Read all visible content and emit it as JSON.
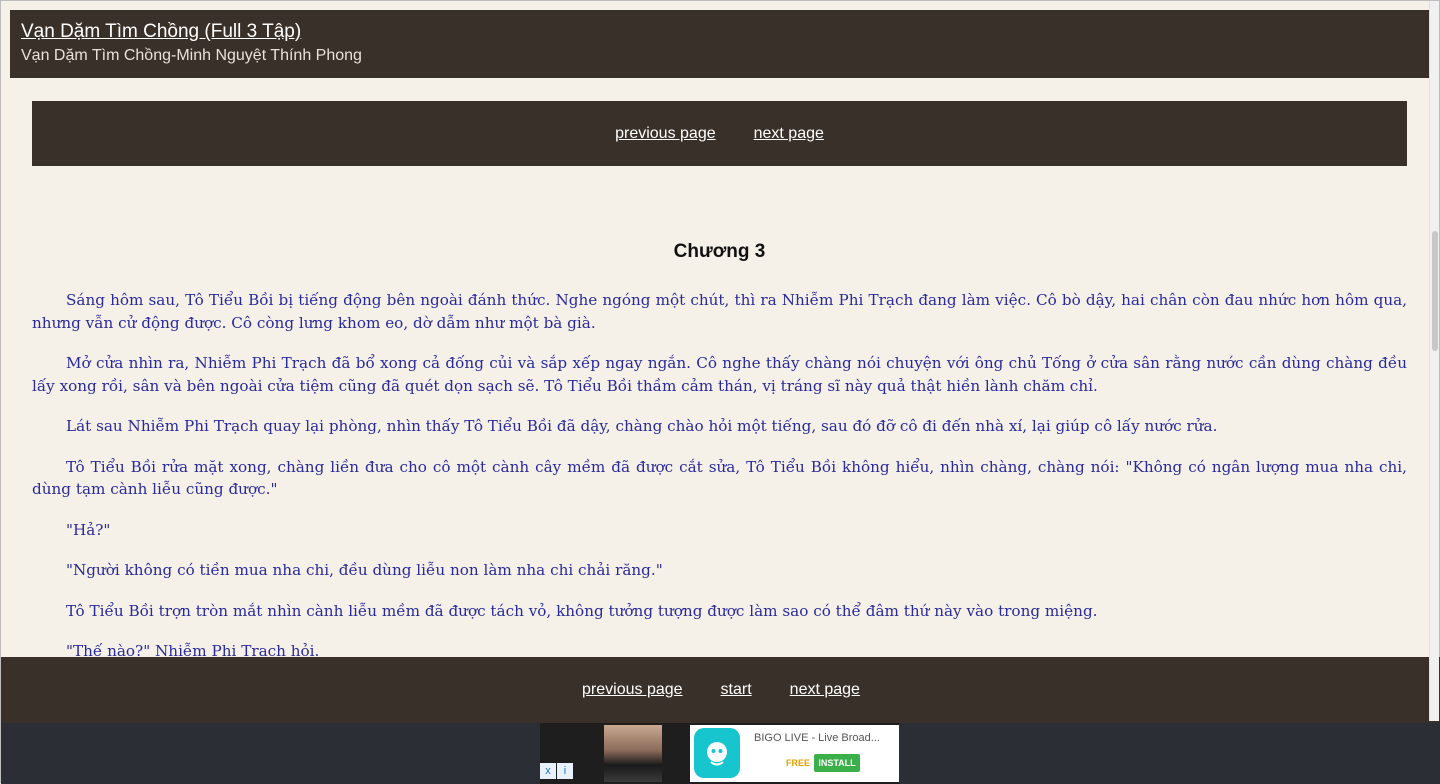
{
  "header": {
    "title": "Vạn Dặm Tìm Chồng (Full 3 Tập)",
    "subtitle": "Vạn Dặm Tìm Chồng-Minh Nguyệt Thính Phong"
  },
  "topnav": {
    "previous": "previous page",
    "next": "next page"
  },
  "chapter": {
    "title": "Chương 3",
    "paragraphs": [
      "Sáng hôm sau, Tô Tiểu Bồi bị tiếng động bên ngoài đánh thức. Nghe ngóng một chút, thì ra Nhiễm Phi Trạch đang làm việc. Cô bò dậy, hai chân còn đau nhức hơn hôm qua, nhưng vẫn cử động được. Cô còng lưng khom eo, dờ dẫm như một bà già.",
      "Mở cửa nhìn ra, Nhiễm Phi Trạch đã bổ xong cả đống củi và sắp xếp ngay ngắn. Cô nghe thấy chàng nói chuyện với ông chủ Tống ở cửa sân rằng nước cần dùng chàng đều lấy xong rồi, sân và bên ngoài cửa tiệm cũng đã quét dọn sạch sẽ. Tô Tiểu Bồi thầm cảm thán, vị tráng sĩ này quả thật hiền lành chăm chỉ.",
      "Lát sau Nhiễm Phi Trạch quay lại phòng, nhìn thấy Tô Tiểu Bồi đã dậy, chàng chào hỏi một tiếng, sau đó đỡ cô đi đến nhà xí, lại giúp cô lấy nước rửa.",
      "Tô Tiểu Bồi rửa mặt xong, chàng liền đưa cho cô một cành cây mềm đã được cắt sửa, Tô Tiểu Bồi không hiểu, nhìn chàng, chàng nói: \"Không có ngân lượng mua nha chi, dùng tạm cành liễu cũng được.\"",
      "\"Hả?\"",
      "\"Người không có tiền mua nha chi, đều dùng liễu non làm nha chi chải răng.\"",
      "Tô Tiểu Bồi trợn tròn mắt nhìn cành liễu mềm đã được tách vỏ, không tưởng tượng được làm sao có thể đâm thứ này vào trong miệng.",
      "\"Thế nào?\" Nhiễm Phi Trạch hỏi."
    ]
  },
  "bottomnav": {
    "previous": "previous page",
    "start": "start",
    "next": "next page"
  },
  "ad": {
    "app_name": "BIGO LIVE - Live Broad...",
    "free_label": "FREE",
    "install_label": "INSTALL",
    "logo_icon": "bigo-logo-icon",
    "close_marks": [
      "x",
      "i"
    ]
  }
}
